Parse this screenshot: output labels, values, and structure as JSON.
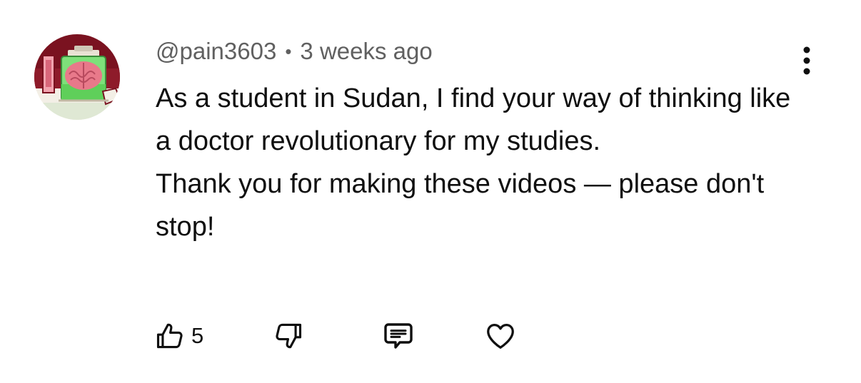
{
  "comment": {
    "author": "@pain3603",
    "separator": "•",
    "timestamp": "3 weeks ago",
    "body_lines": [
      "As a student in Sudan, I find your way of thinking like a doctor revolutionary for my studies.",
      "Thank you for making these videos — please don't stop!"
    ],
    "like_count": "5"
  },
  "icons": {
    "menu": "more-vertical-icon",
    "like": "thumbs-up-icon",
    "dislike": "thumbs-down-icon",
    "reply": "comment-icon",
    "heart": "heart-icon"
  },
  "colors": {
    "meta_text": "#606060",
    "body_text": "#0f0f0f",
    "avatar_bg": "#7a1220",
    "avatar_jar": "#7ee07a",
    "avatar_brain": "#e8798a"
  }
}
